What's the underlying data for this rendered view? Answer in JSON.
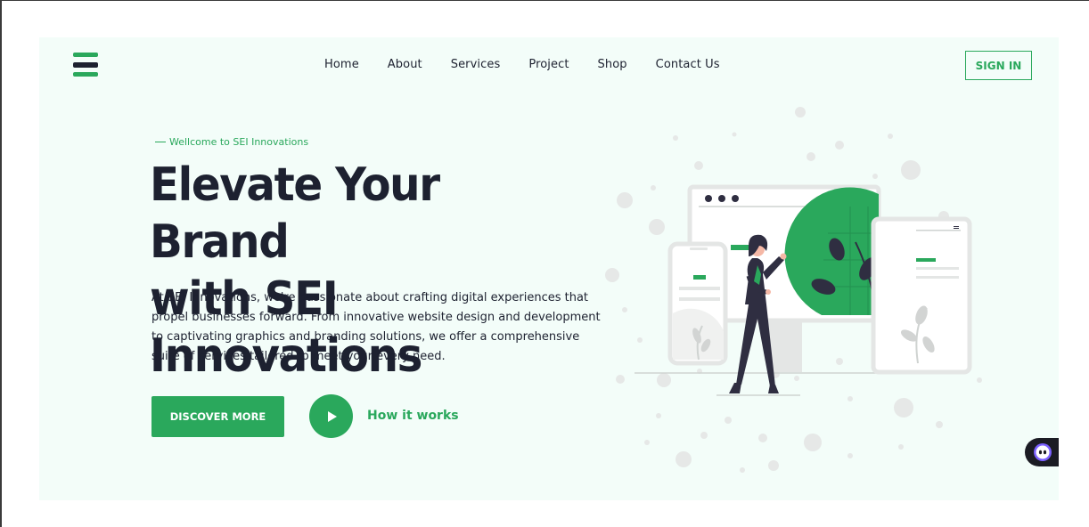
{
  "header": {
    "logo": "sei-logo",
    "nav": [
      "Home",
      "About",
      "Services",
      "Project",
      "Shop",
      "Contact Us"
    ],
    "signin": "SIGN IN"
  },
  "hero": {
    "tagline": "Wellcome to SEI Innovations",
    "headline_line1": "Elevate Your Brand",
    "headline_line2": "with SEI Innovations",
    "description": "At SEI Innovations, we're passionate about crafting digital experiences that propel businesses forward. From innovative website design and development to captivating graphics and branding solutions, we offer a comprehensive suite of services tailored to meet your every need.",
    "primary_button": "DISCOVER MORE",
    "secondary_link": "How it works"
  },
  "colors": {
    "accent": "#2aa85c",
    "text_dark": "#1d2130",
    "hero_background": "#f3fdf9"
  },
  "icons": {
    "play": "play-icon",
    "chat": "chat-bot-icon"
  }
}
